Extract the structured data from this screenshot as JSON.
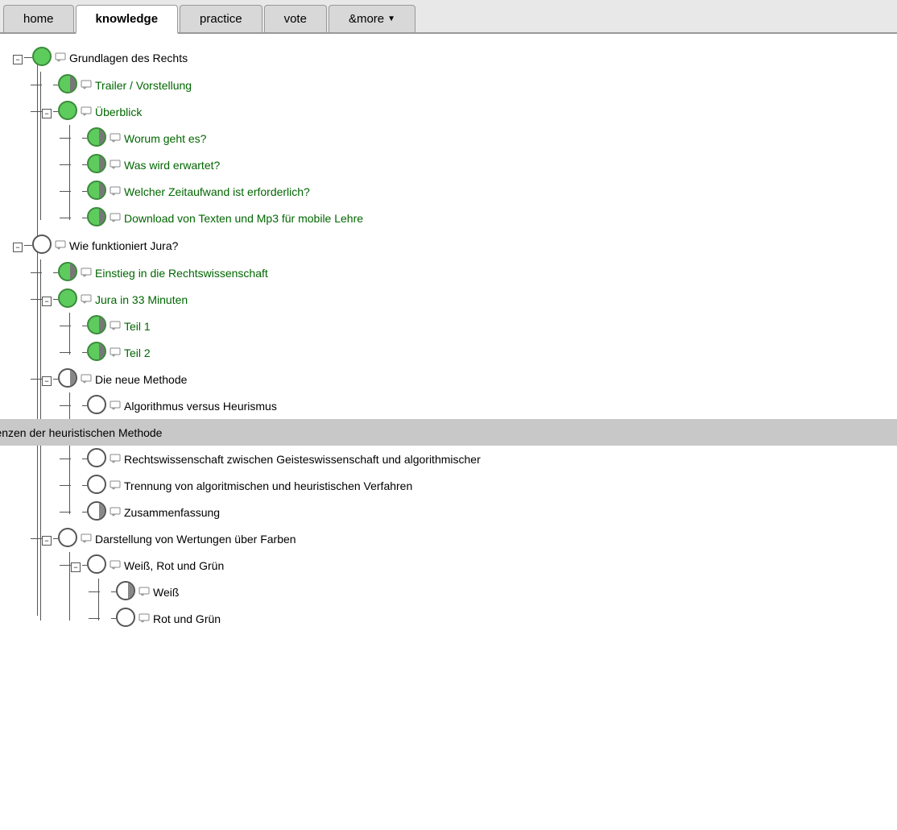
{
  "nav": {
    "tabs": [
      {
        "id": "home",
        "label": "home",
        "active": false
      },
      {
        "id": "knowledge",
        "label": "knowledge",
        "active": true
      },
      {
        "id": "practice",
        "label": "practice",
        "active": false
      },
      {
        "id": "vote",
        "label": "vote",
        "active": false
      },
      {
        "id": "more",
        "label": "&more",
        "active": false,
        "hasDropdown": true
      }
    ]
  },
  "tree": {
    "nodes": [
      {
        "id": "grundlagen",
        "label": "Grundlagen des Rechts",
        "level": 0,
        "hasExpand": true,
        "expandState": "minus",
        "circleType": "green",
        "hasComment": true,
        "labelColor": "black",
        "children": [
          {
            "id": "trailer",
            "label": "Trailer / Vorstellung",
            "level": 1,
            "circleType": "green-half",
            "hasComment": true,
            "labelColor": "green"
          },
          {
            "id": "ueberblick",
            "label": "Überblick",
            "level": 1,
            "hasExpand": true,
            "expandState": "minus",
            "circleType": "green",
            "hasComment": true,
            "labelColor": "green",
            "children": [
              {
                "id": "worum",
                "label": "Worum geht es?",
                "level": 2,
                "circleType": "green-half",
                "hasComment": true,
                "labelColor": "green"
              },
              {
                "id": "waswird",
                "label": "Was wird erwartet?",
                "level": 2,
                "circleType": "green-half",
                "hasComment": true,
                "labelColor": "green"
              },
              {
                "id": "welcher",
                "label": "Welcher Zeitaufwand ist erforderlich?",
                "level": 2,
                "circleType": "green-half",
                "hasComment": true,
                "labelColor": "green"
              },
              {
                "id": "download",
                "label": "Download von Texten und Mp3 für mobile Lehre",
                "level": 2,
                "circleType": "green-half",
                "hasComment": true,
                "labelColor": "green"
              }
            ]
          }
        ]
      },
      {
        "id": "wiefunktioniert",
        "label": "Wie funktioniert Jura?",
        "level": 0,
        "hasExpand": true,
        "expandState": "minus",
        "circleType": "white",
        "hasComment": true,
        "labelColor": "black",
        "children": [
          {
            "id": "einstieg",
            "label": "Einstieg in die Rechtswissenschaft",
            "level": 1,
            "circleType": "green-half",
            "hasComment": true,
            "labelColor": "green"
          },
          {
            "id": "jura33",
            "label": "Jura in 33 Minuten",
            "level": 1,
            "hasExpand": true,
            "expandState": "minus",
            "circleType": "green",
            "hasComment": true,
            "labelColor": "green",
            "children": [
              {
                "id": "teil1",
                "label": "Teil 1",
                "level": 2,
                "circleType": "green-half",
                "hasComment": true,
                "labelColor": "green"
              },
              {
                "id": "teil2",
                "label": "Teil 2",
                "level": 2,
                "circleType": "green-half",
                "hasComment": true,
                "labelColor": "green"
              }
            ]
          },
          {
            "id": "dieneue",
            "label": "Die neue Methode",
            "level": 1,
            "hasExpand": true,
            "expandState": "minus",
            "circleType": "white-half",
            "hasComment": true,
            "labelColor": "black",
            "children": [
              {
                "id": "algorithmus",
                "label": "Algorithmus versus Heurismus",
                "level": 2,
                "circleType": "white",
                "hasComment": true,
                "labelColor": "black"
              },
              {
                "id": "diegrenzen",
                "label": "Die Grenzen der heuristischen Methode",
                "level": 2,
                "circleType": "white-half",
                "hasComment": true,
                "labelColor": "black",
                "highlighted": true
              },
              {
                "id": "rechtswissen",
                "label": "Rechtswissenschaft zwischen Geisteswissenschaft und algorithmischer",
                "level": 2,
                "circleType": "white",
                "hasComment": true,
                "labelColor": "black"
              },
              {
                "id": "trennung",
                "label": "Trennung von algoritmischen und heuristischen Verfahren",
                "level": 2,
                "circleType": "white",
                "hasComment": true,
                "labelColor": "black"
              },
              {
                "id": "zusammen",
                "label": "Zusammenfassung",
                "level": 2,
                "circleType": "white-half",
                "hasComment": true,
                "labelColor": "black"
              }
            ]
          },
          {
            "id": "darstellung",
            "label": "Darstellung von Wertungen über Farben",
            "level": 1,
            "hasExpand": true,
            "expandState": "minus",
            "circleType": "white",
            "hasComment": true,
            "labelColor": "black",
            "children": [
              {
                "id": "weissrotgruen",
                "label": "Weiß, Rot und Grün",
                "level": 2,
                "hasExpand": true,
                "expandState": "minus",
                "circleType": "white",
                "hasComment": true,
                "labelColor": "black",
                "children": [
                  {
                    "id": "weiss",
                    "label": "Weiß",
                    "level": 3,
                    "circleType": "white-half",
                    "hasComment": true,
                    "labelColor": "black"
                  },
                  {
                    "id": "rotundgruen",
                    "label": "Rot und Grün",
                    "level": 3,
                    "circleType": "white",
                    "hasComment": true,
                    "labelColor": "black"
                  }
                ]
              }
            ]
          }
        ]
      }
    ]
  }
}
